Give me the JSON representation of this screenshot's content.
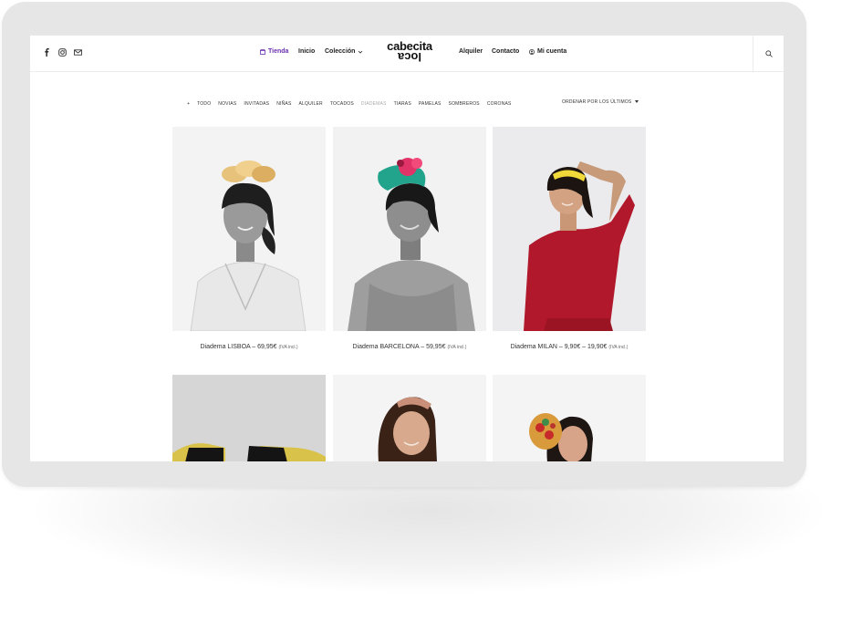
{
  "header": {
    "nav_left": [
      {
        "label": "Tienda",
        "active": true,
        "icon": "store-icon"
      },
      {
        "label": "Inicio"
      },
      {
        "label": "Colección",
        "has_dropdown": true
      }
    ],
    "logo": {
      "line1": "cabecita",
      "line2": "loca"
    },
    "nav_right": [
      {
        "label": "Alquiler"
      },
      {
        "label": "Contacto"
      },
      {
        "label": "Mi cuenta",
        "icon": "user-icon"
      }
    ],
    "social_icons": [
      "facebook-icon",
      "instagram-icon",
      "mail-icon"
    ],
    "search_icon": "search-icon"
  },
  "filters": {
    "items": [
      "+",
      "TODO",
      "NOVIAS",
      "INVITADAS",
      "NIÑAS",
      "ALQUILER",
      "TOCADOS",
      "DIADEMAS",
      "TIARAS",
      "PAMELAS",
      "SOMBREROS",
      "CORONAS"
    ],
    "dimmed": "DIADEMAS",
    "sort_label": "ORDENAR POR LOS ÚLTIMOS"
  },
  "products": [
    {
      "name": "Diadema LISBOA",
      "price": "69,95€",
      "tax": "(IVA incl.)"
    },
    {
      "name": "Diadema BARCELONA",
      "price": "59,95€",
      "tax": "(IVA incl.)"
    },
    {
      "name": "Diadema MILAN",
      "price": "9,90€ – 19,90€",
      "tax": "(IVA incl.)"
    }
  ],
  "colors": {
    "accent": "#6a2fb0",
    "device_frame": "#e6e6e6",
    "text": "#222222"
  }
}
